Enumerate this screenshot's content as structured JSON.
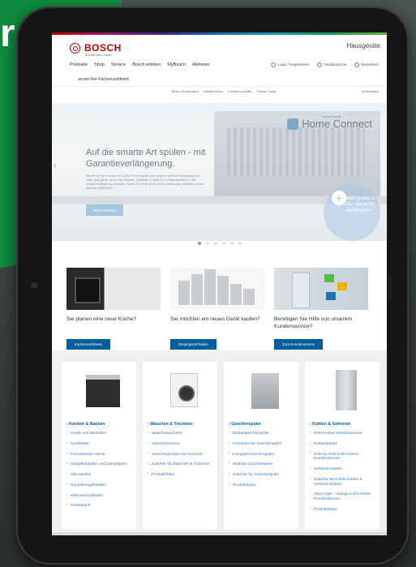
{
  "background": {
    "partial_text": "r"
  },
  "header": {
    "brand": "BOSCH",
    "tagline": "Technik fürs Leben",
    "section": "Hausgeräte"
  },
  "nav": {
    "items": [
      "Produkte",
      "Shop",
      "Service",
      "Bosch erleben",
      "MyBosch",
      "Aktionen"
    ],
    "sub_item": "accent line Küchensortiment",
    "right": [
      "Login / Registrieren",
      "Händlersuche",
      "Warenkorb"
    ]
  },
  "subnav": {
    "links": [
      "Bosch Deutschland",
      "Händler finden",
      "Kontakt und Hilfe",
      "Presse Center"
    ],
    "country": "Deutschland"
  },
  "hero": {
    "badge_small": "CONNECTED BY",
    "badge": "Home Connect",
    "title": "Auf die smarte Art spülen - mit Garantieverlängerung.",
    "body": "Steuern Sie Ihren neuen EXCLUSIV Geschirrspüler ganz bequem mit Ihrem Smartphone oder Tablet ganz gleich, wo Sie sich befinden. Zusätzlich erhalten Sie im Aktionszeitraum 1 Jahr Garantieverlängerung kostenlos. Einfach Ihr Gerät mit der Home Connect App verbinden und bei MyBosch registrieren.",
    "button": "Mehr erfahren",
    "bubble": "Jetzt gratis 1 Jahr Garantie verlängern*",
    "dots_total": 6,
    "dots_active": 1
  },
  "promos": [
    {
      "text": "Sie planen eine neue Küche?",
      "button": "Küchensortiment"
    },
    {
      "text": "Sie möchten ein neues Gerät kaufen?",
      "button": "Ersatzgerät finden"
    },
    {
      "text": "Benötigen Sie Hilfe von unserem Kundenservice?",
      "button": "Zum Kundenservice"
    }
  ],
  "categories": [
    {
      "title": "Kochen & Backen",
      "items": [
        "Herde und Backöfen",
        "Kochfelder",
        "Freistehende Herde",
        "Dampfbackofen und Dampfgarer",
        "Mikrowellen",
        "Dunstabzugshauben",
        "Wärmeschubladen",
        "Kontaktgrill"
      ]
    },
    {
      "title": "Waschen & Trocknen",
      "items": [
        "Waschmaschinen",
        "Wäschetrockner",
        "Waschmaschine mit Trockner",
        "Zubehör für Waschen & Trocknen",
        "Produktfinder"
      ]
    },
    {
      "title": "Geschirrspüler",
      "items": [
        "Einbaugeschirrspüler",
        "Freistehende Geschirrspüler",
        "Kompakt Geschirrspüler",
        "Modular Geschirrspüler",
        "Zubehör für Geschirrspüler",
        "Produktfinder"
      ]
    },
    {
      "title": "Kühlen & Gefrieren",
      "items": [
        "Kühl-Gefrier-Kombinationen",
        "Kühlschränke",
        "Side-by-Side Kühl-Gefrier-Kombinationen",
        "Gefrierschränke",
        "Zubehör für Kühlschränke & Gefrierschränke",
        "Vario Style – farbige Kühl-Gefrier-Kombinationen",
        "Produktfinder"
      ]
    }
  ],
  "colors": {
    "accent": "#005e9c",
    "brand": "#c20000",
    "link": "#3b7bb3",
    "green_bg": "#0f8a3f"
  }
}
